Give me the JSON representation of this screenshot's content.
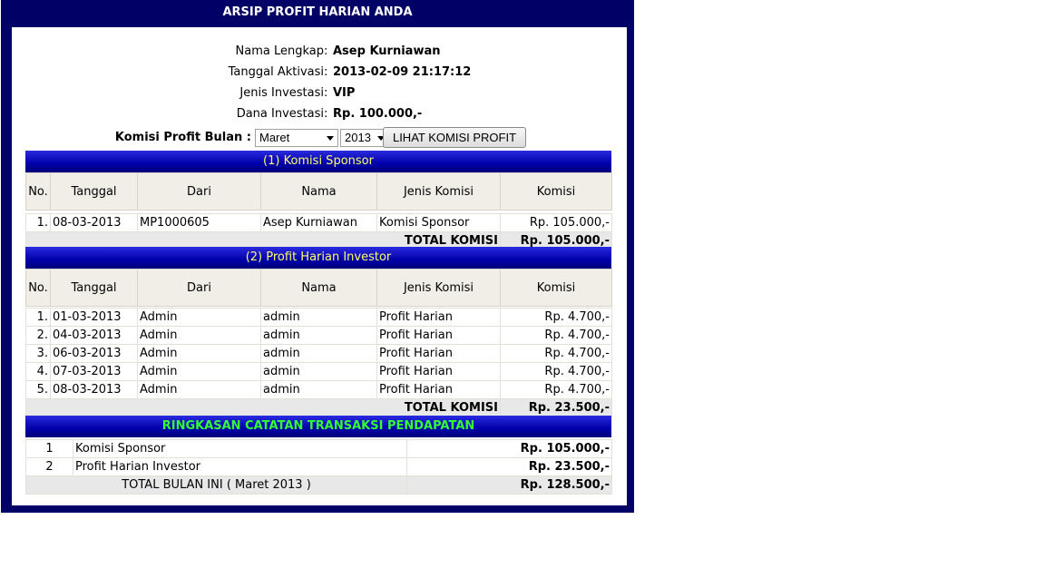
{
  "page_title": "ARSIP PROFIT HARIAN ANDA",
  "info": [
    {
      "label": "Nama Lengkap",
      "value": "Asep Kurniawan"
    },
    {
      "label": "Tanggal Aktivasi",
      "value": "2013-02-09 21:17:12"
    },
    {
      "label": "Jenis Investasi",
      "value": "VIP"
    },
    {
      "label": "Dana Investasi",
      "value": "Rp. 100.000,-"
    }
  ],
  "filter": {
    "label": "Komisi Profit Bulan :",
    "month": "Maret",
    "year": "2013",
    "button": "LIHAT KOMISI PROFIT"
  },
  "columns": [
    "No.",
    "Tanggal",
    "Dari",
    "Nama",
    "Jenis Komisi",
    "Komisi"
  ],
  "sponsor": {
    "title": "(1) Komisi Sponsor",
    "rows": [
      {
        "no": "1.",
        "tanggal": "08-03-2013",
        "dari": "MP1000605",
        "nama": "Asep Kurniawan",
        "jenis": "Komisi Sponsor",
        "komisi": "Rp. 105.000,-"
      }
    ],
    "total_label": "TOTAL KOMISI",
    "total_value": "Rp. 105.000,-"
  },
  "investor": {
    "title": "(2) Profit Harian Investor",
    "rows": [
      {
        "no": "1.",
        "tanggal": "01-03-2013",
        "dari": "Admin",
        "nama": "admin",
        "jenis": "Profit Harian",
        "komisi": "Rp. 4.700,-"
      },
      {
        "no": "2.",
        "tanggal": "04-03-2013",
        "dari": "Admin",
        "nama": "admin",
        "jenis": "Profit Harian",
        "komisi": "Rp. 4.700,-"
      },
      {
        "no": "3.",
        "tanggal": "06-03-2013",
        "dari": "Admin",
        "nama": "admin",
        "jenis": "Profit Harian",
        "komisi": "Rp. 4.700,-"
      },
      {
        "no": "4.",
        "tanggal": "07-03-2013",
        "dari": "Admin",
        "nama": "admin",
        "jenis": "Profit Harian",
        "komisi": "Rp. 4.700,-"
      },
      {
        "no": "5.",
        "tanggal": "08-03-2013",
        "dari": "Admin",
        "nama": "admin",
        "jenis": "Profit Harian",
        "komisi": "Rp. 4.700,-"
      }
    ],
    "total_label": "TOTAL KOMISI",
    "total_value": "Rp. 23.500,-"
  },
  "summary": {
    "title": "RINGKASAN CATATAN TRANSAKSI PENDAPATAN",
    "rows": [
      {
        "no": "1",
        "label": "Komisi Sponsor",
        "value": "Rp. 105.000,-"
      },
      {
        "no": "2",
        "label": "Profit Harian Investor",
        "value": "Rp. 23.500,-"
      }
    ],
    "total_label": "TOTAL BULAN INI ( Maret 2013 )",
    "total_value": "Rp. 128.500,-"
  },
  "colors": {
    "frame": "#000066",
    "bar": "#0000aa",
    "bar_text_yellow": "#ffff66",
    "bar_text_green": "#33ff33"
  }
}
